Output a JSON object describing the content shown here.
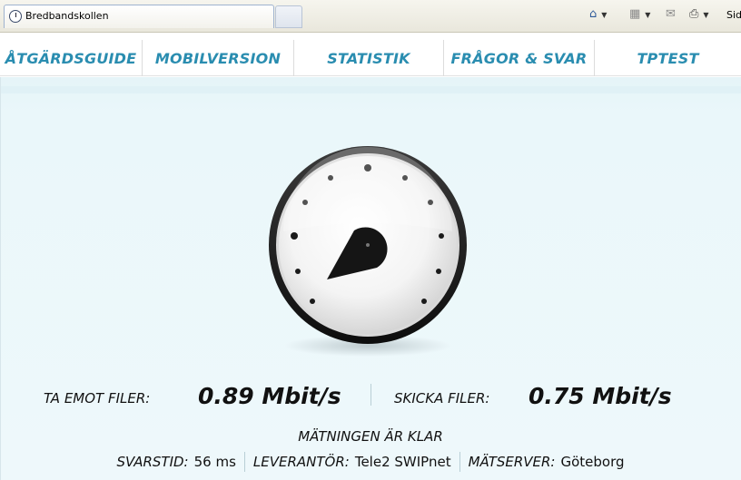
{
  "browser": {
    "tab_title": "Bredbandskollen",
    "icons": [
      "home-icon",
      "feeds-icon",
      "mail-icon",
      "print-icon"
    ],
    "side_text": "Sid"
  },
  "nav": {
    "items": [
      "ÅTGÄRDSGUIDE",
      "MOBILVERSION",
      "STATISTIK",
      "FRÅGOR & SVAR",
      "TPTEST"
    ]
  },
  "colors": {
    "nav_text": "#2a8db0",
    "content_bg": "#eaf7fa"
  },
  "result": {
    "download_label": "TA EMOT FILER:",
    "download_value": "0.89 Mbit/s",
    "upload_label": "SKICKA FILER:",
    "upload_value": "0.75 Mbit/s",
    "status": "MÄTNINGEN ÄR KLAR",
    "response_label": "SVARSTID:",
    "response_value": "56 ms",
    "provider_label": "LEVERANTÖR:",
    "provider_value": "Tele2 SWIPnet",
    "server_label": "MÄTSERVER:",
    "server_value": "Göteborg"
  }
}
